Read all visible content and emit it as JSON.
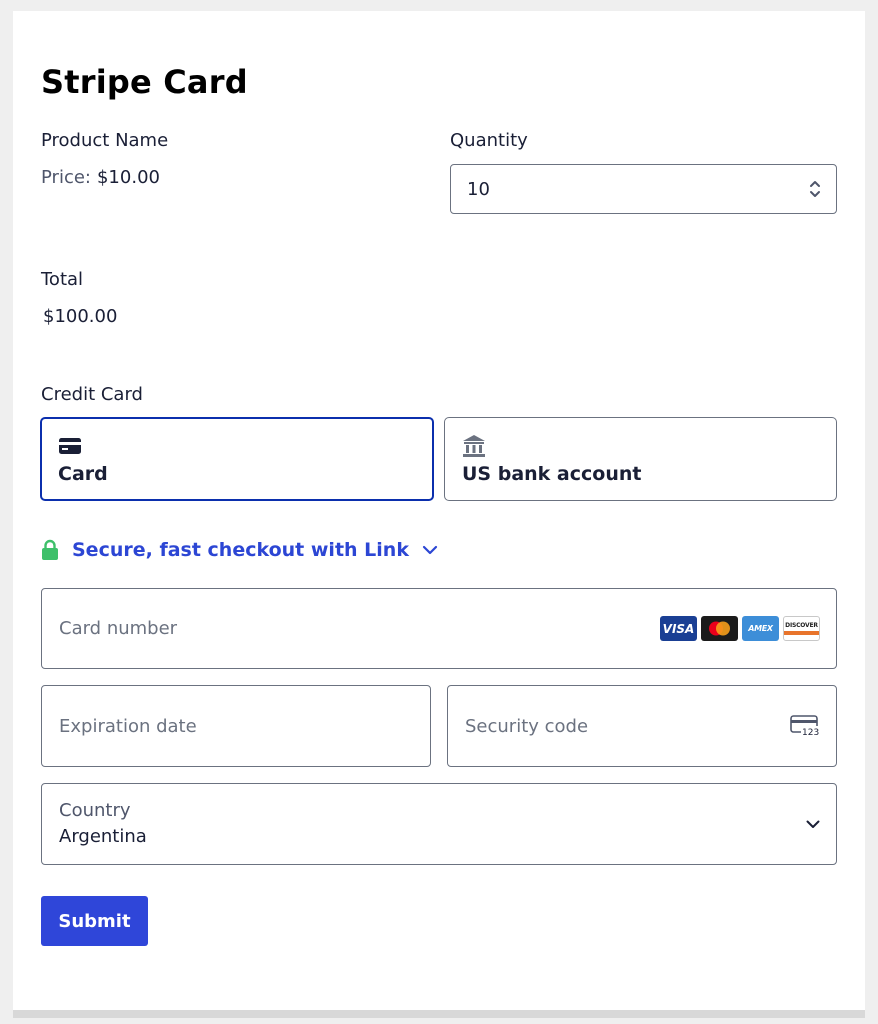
{
  "title": "Stripe Card",
  "product": {
    "name": "Product Name",
    "price_label": "Price:",
    "price_value": "$10.00"
  },
  "quantity": {
    "label": "Quantity",
    "value": "10"
  },
  "total": {
    "label": "Total",
    "value": "$100.00"
  },
  "payment": {
    "section_label": "Credit Card",
    "tabs": [
      {
        "label": "Card",
        "icon": "card-icon",
        "selected": true
      },
      {
        "label": "US bank account",
        "icon": "bank-icon",
        "selected": false
      }
    ],
    "link_text": "Secure, fast checkout with Link",
    "card_number": {
      "placeholder": "Card number"
    },
    "brands": [
      "VISA",
      "AMEX",
      "DISCOVER"
    ],
    "expiration": {
      "placeholder": "Expiration date"
    },
    "security": {
      "placeholder": "Security code",
      "icon_text": "123"
    },
    "country": {
      "label": "Country",
      "value": "Argentina"
    }
  },
  "submit_label": "Submit",
  "colors": {
    "accent": "#2f46d9",
    "link": "#2c46d4",
    "active_border": "#0b2fad",
    "lock": "#3ec06a"
  }
}
